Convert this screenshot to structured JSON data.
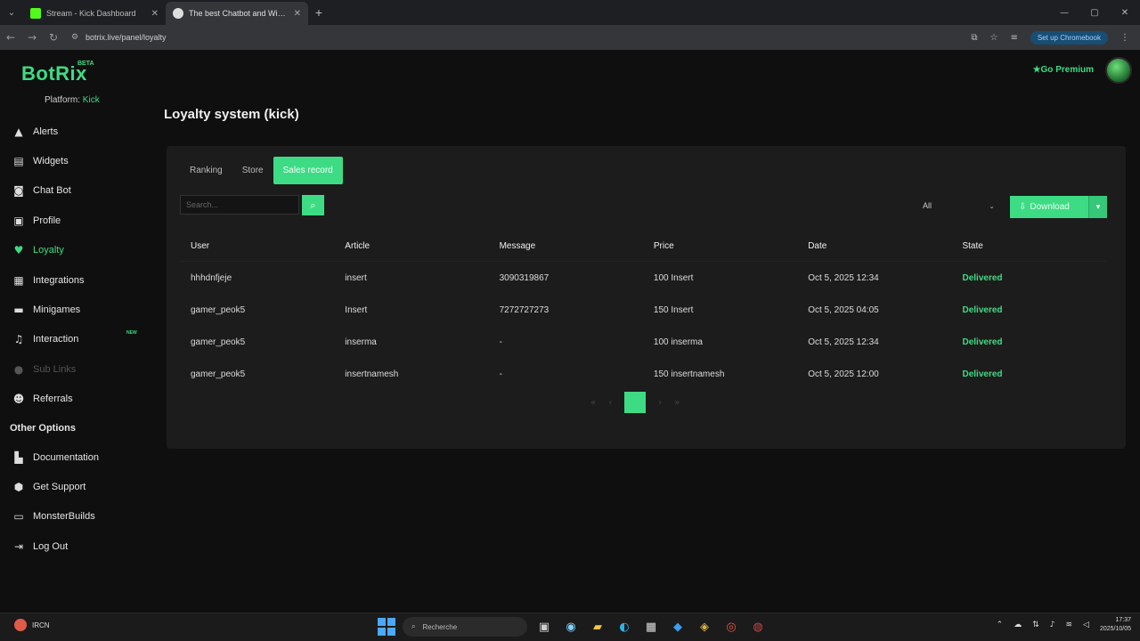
{
  "browser": {
    "tabs": [
      {
        "title": "Stream - Kick Dashboard",
        "favicon_color": "#53fc18",
        "active": false
      },
      {
        "title": "The best Chatbot and Widget...",
        "favicon_color": "#ffffff",
        "active": true
      }
    ],
    "url": "botrix.live/panel/loyalty",
    "resume_label": "Set up Chromebook"
  },
  "app": {
    "logo": "BotRix",
    "beta": "BETA",
    "platform_label": "Platform:",
    "platform_value": "Kick",
    "go_premium": "Go Premium",
    "nav": [
      {
        "label": "Alerts",
        "icon": "warning-icon"
      },
      {
        "label": "Widgets",
        "icon": "widgets-icon"
      },
      {
        "label": "Chat Bot",
        "icon": "bot-icon"
      },
      {
        "label": "Profile",
        "icon": "profile-icon"
      },
      {
        "label": "Loyalty",
        "icon": "loyalty-icon"
      },
      {
        "label": "Integrations",
        "icon": "integrations-icon"
      },
      {
        "label": "Minigames",
        "icon": "gamepad-icon"
      },
      {
        "label": "Interaction",
        "icon": "music-icon",
        "badge": "NEW"
      },
      {
        "label": "Sub Links",
        "icon": "link-icon"
      },
      {
        "label": "Referrals",
        "icon": "users-icon"
      }
    ],
    "other_options_heading": "Other Options",
    "nav2": [
      {
        "label": "Documentation",
        "icon": "book-icon"
      },
      {
        "label": "Get Support",
        "icon": "support-icon"
      },
      {
        "label": "MonsterBuilds",
        "icon": "laptop-icon"
      },
      {
        "label": "Log Out",
        "icon": "logout-icon"
      }
    ],
    "page_title": "Loyalty system (kick)",
    "tabs": [
      "Ranking",
      "Store",
      "Sales record"
    ],
    "search_placeholder": "Search...",
    "filter_value": "All",
    "download_label": "Download",
    "table": {
      "headers": [
        "User",
        "Article",
        "Message",
        "Price",
        "Date",
        "State"
      ],
      "rows": [
        [
          "hhhdnfjeje",
          "insert",
          "3090319867",
          "100 Insert",
          "Oct 5, 2025 12:34",
          "Delivered"
        ],
        [
          "gamer_peok5",
          "Insert",
          "7272727273",
          "150 Insert",
          "Oct 5, 2025 04:05",
          "Delivered"
        ],
        [
          "gamer_peok5",
          "inserma",
          "-",
          "100 inserma",
          "Oct 5, 2025 12:34",
          "Delivered"
        ],
        [
          "gamer_peok5",
          "insertnamesh",
          "-",
          "150 insertnamesh",
          "Oct 5, 2025 12:00",
          "Delivered"
        ]
      ]
    },
    "pagination": {
      "current": "1"
    }
  },
  "taskbar": {
    "weather": "IRCN",
    "search_label": "Recherche",
    "time": "17:37",
    "date": "2025/10/05"
  }
}
